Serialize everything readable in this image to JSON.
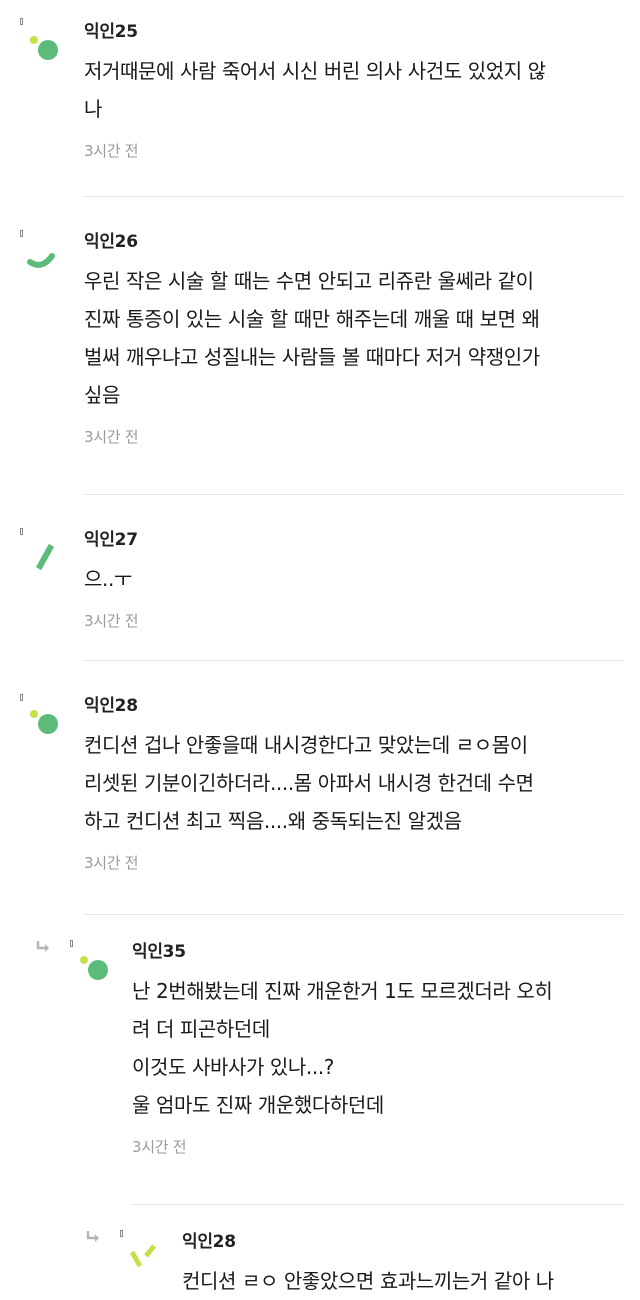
{
  "comments": [
    {
      "nick": "익인25",
      "lines": [
        "저거때문에 사람 죽어서 시신 버린 의사 사건도 있었지 않",
        "나"
      ],
      "time": "3시간 전",
      "avatar": "dots-green"
    },
    {
      "nick": "익인26",
      "lines": [
        "우린 작은 시술 할 때는 수면 안되고 리쥬란 울쎄라 같이",
        "진짜 통증이 있는 시술 할 때만 해주는데 깨울 때 보면 왜",
        "벌써 깨우냐고 성질내는 사람들 볼 때마다 저거 약쟁인가",
        "싶음"
      ],
      "time": "3시간 전",
      "avatar": "arc-green"
    },
    {
      "nick": "익인27",
      "lines": [
        "으..ㅜ"
      ],
      "time": "3시간 전",
      "avatar": "slash-green"
    },
    {
      "nick": "익인28",
      "lines": [
        "컨디션 겁나 안좋을때 내시경한다고 맞았는데 ㄹㅇ몸이",
        "리셋된 기분이긴하더라....몸 아파서 내시경 한건데 수면",
        "하고 컨디션 최고 찍음....왜 중독되는진 알겠음"
      ],
      "time": "3시간 전",
      "avatar": "dots-green"
    },
    {
      "nick": "익인35",
      "lines": [
        "난 2번해봤는데 진짜 개운한거 1도 모르겠더라 오히",
        "려 더 피곤하던데",
        "이것도 사바사가 있나...?",
        "울 엄마도 진짜 개운했다하던데"
      ],
      "time": "3시간 전",
      "avatar": "dots-green",
      "reply": true
    },
    {
      "nick": "익인28",
      "lines": [
        "컨디션 ㄹㅇ 안좋았으면 효과느끼는거 같아 나"
      ],
      "time": "",
      "avatar": "dashes-lime",
      "reply": true
    }
  ],
  "colors": {
    "green": "#5dbb7a",
    "lime": "#c6e04a",
    "time": "#9a9a9a",
    "divider": "#e6e6e6"
  },
  "icons": {
    "reply": "reply-arrow-icon"
  }
}
